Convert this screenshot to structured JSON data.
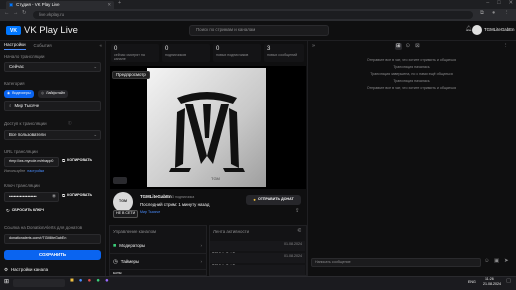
{
  "browser": {
    "tab_title": "Студия - VK Play Live",
    "url": "live.vkplay.ru",
    "window_controls": [
      "–",
      "□",
      "✕"
    ]
  },
  "header": {
    "logo_text": "VK",
    "brand": "VK Play Live",
    "search_placeholder": "Поиск по стримам и каналам",
    "username": "TGMLiteGabEn"
  },
  "left": {
    "tabs": [
      "Настройки",
      "События"
    ],
    "stream_start_label": "Начало трансляции",
    "stream_start_value": "Сейчас",
    "category_label": "Категория",
    "category_chips": [
      "Видеоигры",
      "Лайфстайл"
    ],
    "category_value": "Мир Тысяче",
    "access_label": "Доступ к трансляции",
    "access_value": "Все пользователи",
    "url_label": "URL трансляции",
    "url_value": "rtmp://ws.myrcde.m/ebapp0",
    "copy_label": "КОПИРОВАТЬ",
    "alt_hint": "Используйте",
    "alt_link": "настройки",
    "key_label": "Ключ трансляции",
    "key_value": "••••••••••••••••••",
    "reset_key": "СБРОСИТЬ КЛЮЧ",
    "donation_label": "Ссылка на DonationAlerts для донатов",
    "donation_value": "donationalerts.com/r/TGMliteGabEn",
    "save_label": "СОХРАНИТЬ",
    "chat_settings": "Настройки канала"
  },
  "stats": [
    {
      "num": "0",
      "label": "сейчас смотрят на канале"
    },
    {
      "num": "0",
      "label": "подписчиков"
    },
    {
      "num": "0",
      "label": "новых подписчиков"
    },
    {
      "num": "3",
      "label": "новых сообщений"
    }
  ],
  "preview_label": "Предпросмотр",
  "channel": {
    "avatar_text": "TGM",
    "offline": "НЕ В СЕТИ",
    "name": "TGMLiteGabEn",
    "followers": "3 подписчика",
    "last_stream": "Последний стрим: 1 минуту назад",
    "game": "Мир Тысяче",
    "donate_button": "ОТПРАВИТЬ ДОНАТ"
  },
  "manager": {
    "title": "Управление каналом",
    "items": [
      "Модераторы",
      "Таймеры",
      "Боты"
    ]
  },
  "feed": {
    "title": "Лента активности",
    "rows": [
      {
        "text": "TGMLiteGabEn ● в эту трансляцию",
        "date": "01.08.2024"
      },
      {
        "text": "TGMLiteGabEn ● в эту трансляцию",
        "date": "01.08.2024"
      },
      {
        "text": "Коллаборация Кампочи Тухуре Реднеку №1",
        "date": ""
      }
    ]
  },
  "chat": {
    "messages": [
      "Отправьте все в чат, что хотите стримить и общаться",
      "Трансляция началась",
      "Трансляция завершена, но с нами ещё общаться",
      "Трансляция началась",
      "Отправьте все в чат, что хотите стримить и общаться"
    ],
    "input_placeholder": "Написать сообщение"
  },
  "taskbar": {
    "time": "11:26",
    "date": "21.08.2024",
    "lang": "ENG"
  },
  "colors": {
    "accent": "#0a64f0",
    "bg": "#0f0f10",
    "panel": "#131315"
  }
}
